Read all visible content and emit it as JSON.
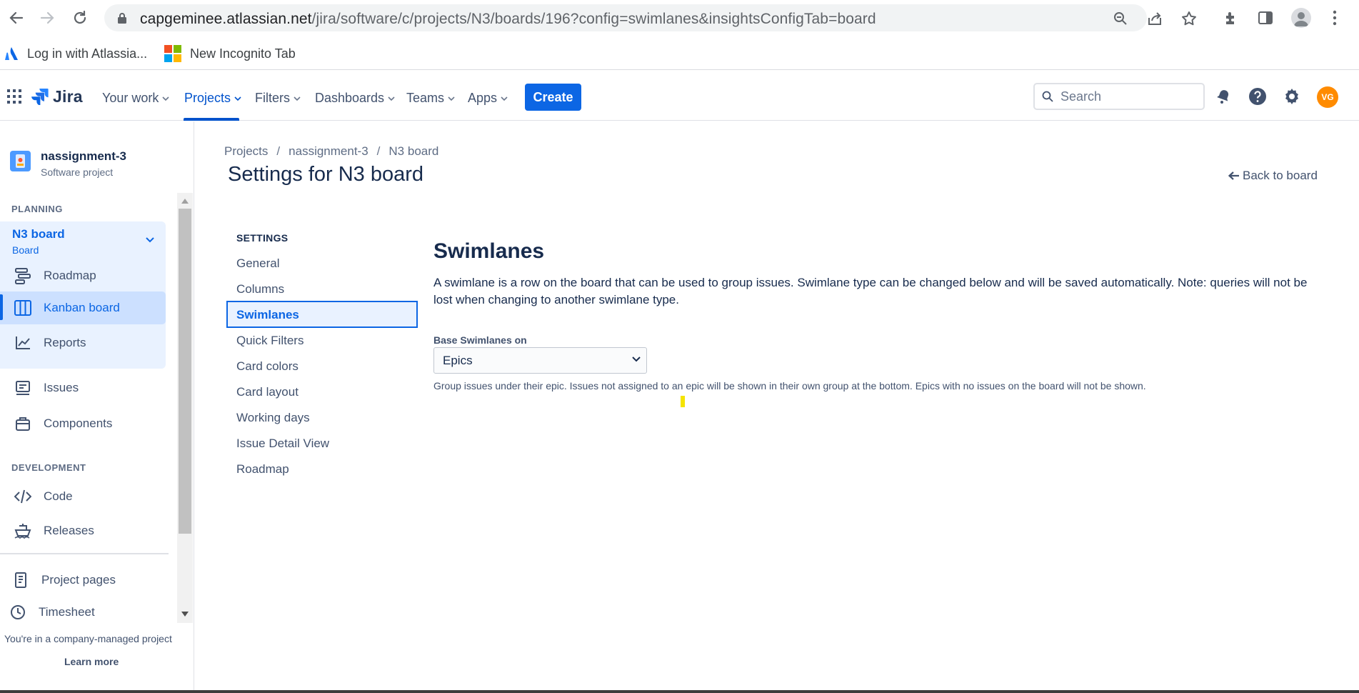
{
  "browser": {
    "url_host": "capgeminee.atlassian.net",
    "url_path": "/jira/software/c/projects/N3/boards/196?config=swimlanes&insightsConfigTab=board",
    "bookmarks": [
      "Log in with Atlassia...",
      "New Incognito Tab"
    ]
  },
  "topnav": {
    "product": "Jira",
    "menu": [
      "Your work",
      "Projects",
      "Filters",
      "Dashboards",
      "Teams",
      "Apps"
    ],
    "active_menu": "Projects",
    "create_label": "Create",
    "search_placeholder": "Search",
    "user_initials": "VG"
  },
  "sidebar": {
    "project_name": "nassignment-3",
    "project_type": "Software project",
    "planning_header": "PLANNING",
    "board_title": "N3 board",
    "board_sub": "Board",
    "planning_items": [
      "Roadmap",
      "Kanban board",
      "Reports"
    ],
    "selected_item": "Kanban board",
    "other_items": [
      "Issues",
      "Components"
    ],
    "development_header": "DEVELOPMENT",
    "dev_items": [
      "Code",
      "Releases"
    ],
    "footer_items": [
      "Project pages",
      "Timesheet"
    ],
    "company_note": "You're in a company-managed project",
    "learn_more": "Learn more"
  },
  "main": {
    "breadcrumb": [
      "Projects",
      "nassignment-3",
      "N3 board"
    ],
    "title": "Settings for N3 board",
    "back_link": "Back to board",
    "settings_header": "SETTINGS",
    "settings_items": [
      "General",
      "Columns",
      "Swimlanes",
      "Quick Filters",
      "Card colors",
      "Card layout",
      "Working days",
      "Issue Detail View",
      "Roadmap"
    ],
    "selected_setting": "Swimlanes",
    "section_title": "Swimlanes",
    "section_desc": "A swimlane is a row on the board that can be used to group issues. Swimlane type can be changed below and will be saved automatically. Note: queries will not be lost when changing to another swimlane type.",
    "base_label": "Base Swimlanes on",
    "base_value": "Epics",
    "base_help": "Group issues under their epic. Issues not assigned to an epic will be shown in their own group at the bottom. Epics with no issues on the board will not be shown."
  },
  "colors": {
    "accent": "#0c66e4",
    "selected_bg": "#e9f2ff",
    "user_avatar": "#ff8b00"
  }
}
